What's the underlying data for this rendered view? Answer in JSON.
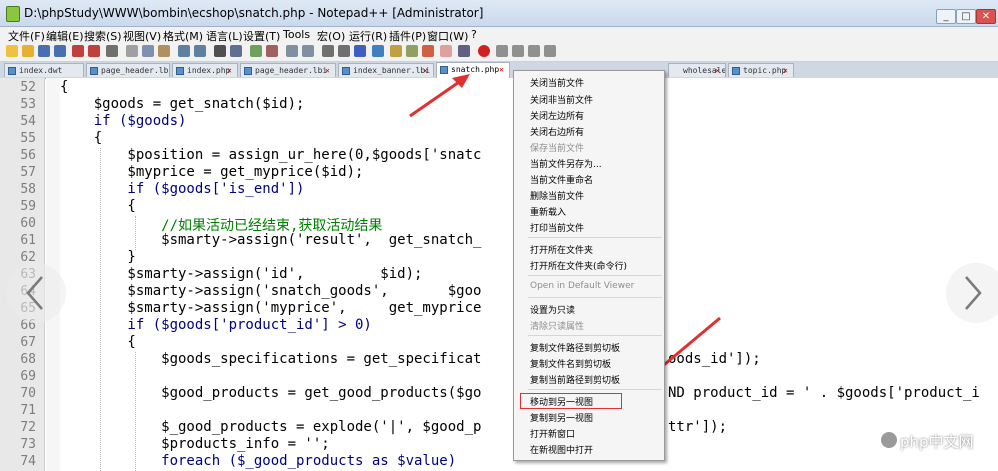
{
  "window": {
    "title": "D:\\phpStudy\\WWW\\bombin\\ecshop\\snatch.php - Notepad++ [Administrator]",
    "min": "_",
    "max": "□",
    "close": "✕"
  },
  "menu": [
    "文件(F)",
    "编辑(E)",
    "搜索(S)",
    "视图(V)",
    "格式(M)",
    "语言(L)",
    "设置(T)",
    "Tools",
    "宏(O)",
    "运行(R)",
    "插件(P)",
    "窗口(W)",
    "?"
  ],
  "tabs": [
    "index.dwt",
    "page_header.lbi",
    "index.php",
    "page_header.lbi",
    "index_banner.lbi",
    "snatch.php",
    "",
    "wholesale.php",
    "topic.php"
  ],
  "editor": {
    "line_numbers": [
      "52",
      "53",
      "54",
      "55",
      "56",
      "57",
      "58",
      "59",
      "60",
      "61",
      "62",
      "63",
      "64",
      "65",
      "66",
      "67",
      "68",
      "69",
      "70",
      "71",
      "72",
      "73",
      "74"
    ],
    "lines": [
      "{",
      "    $goods = get_snatch($id);",
      "    if ($goods)",
      "    {",
      "        $position = assign_ur_here(0,$goods['snatc",
      "        $myprice = get_myprice($id);",
      "        if ($goods['is_end'])",
      "        {",
      "            //如果活动已经结束,获取活动结果",
      "            $smarty->assign('result',  get_snatch_",
      "        }",
      "        $smarty->assign('id',         $id);",
      "        $smarty->assign('snatch_goods',       $goo",
      "        $smarty->assign('myprice',     get_myprice",
      "        if ($goods['product_id'] > 0)",
      "        {",
      "            $goods_specifications = get_specificat",
      "",
      "            $good_products = get_good_products($go",
      "",
      "            $_good_products = explode('|', $good_p",
      "            $products_info = '';",
      "            foreach ($_good_products as $value)"
    ],
    "overflow_fragments": {
      "line68": "oods_id']);",
      "line70": "ND product_id = ' . $goods['product_i",
      "line72": "ttr']);"
    }
  },
  "context_menu": {
    "items": [
      {
        "label": "关闭当前文件",
        "disabled": false
      },
      {
        "label": "关闭非当前文件",
        "disabled": false
      },
      {
        "label": "关闭左边所有",
        "disabled": false
      },
      {
        "label": "关闭右边所有",
        "disabled": false
      },
      {
        "label": "保存当前文件",
        "disabled": true
      },
      {
        "label": "当前文件另存为...",
        "disabled": false
      },
      {
        "label": "当前文件重命名",
        "disabled": false
      },
      {
        "label": "删除当前文件",
        "disabled": false
      },
      {
        "label": "重新载入",
        "disabled": false
      },
      {
        "label": "打印当前文件",
        "disabled": false
      },
      {
        "label": "打开所在文件夹",
        "disabled": false
      },
      {
        "label": "打开所在文件夹(命令行)",
        "disabled": false
      },
      {
        "label": "Open in Default Viewer",
        "disabled": true
      },
      {
        "label": "设置为只读",
        "disabled": false
      },
      {
        "label": "清除只读属性",
        "disabled": true
      },
      {
        "label": "复制文件路径到剪切板",
        "disabled": false
      },
      {
        "label": "复制文件名到剪切板",
        "disabled": false
      },
      {
        "label": "复制当前路径到剪切板",
        "disabled": false
      },
      {
        "label": "移动到另一视图",
        "disabled": false,
        "highlighted": true
      },
      {
        "label": "复制到另一视图",
        "disabled": false
      },
      {
        "label": "打开新窗口",
        "disabled": false
      },
      {
        "label": "在新视图中打开",
        "disabled": false
      }
    ]
  },
  "watermark": {
    "text": "php中文网"
  },
  "colors": {
    "annotation_red": "#e03030",
    "keyword_blue": "#0000ff",
    "comment_green": "#008000",
    "string_gray": "#808080"
  },
  "icons": [
    "left-arrow-icon",
    "right-arrow-icon",
    "notepad-app-icon",
    "save-icon",
    "close-icon"
  ]
}
